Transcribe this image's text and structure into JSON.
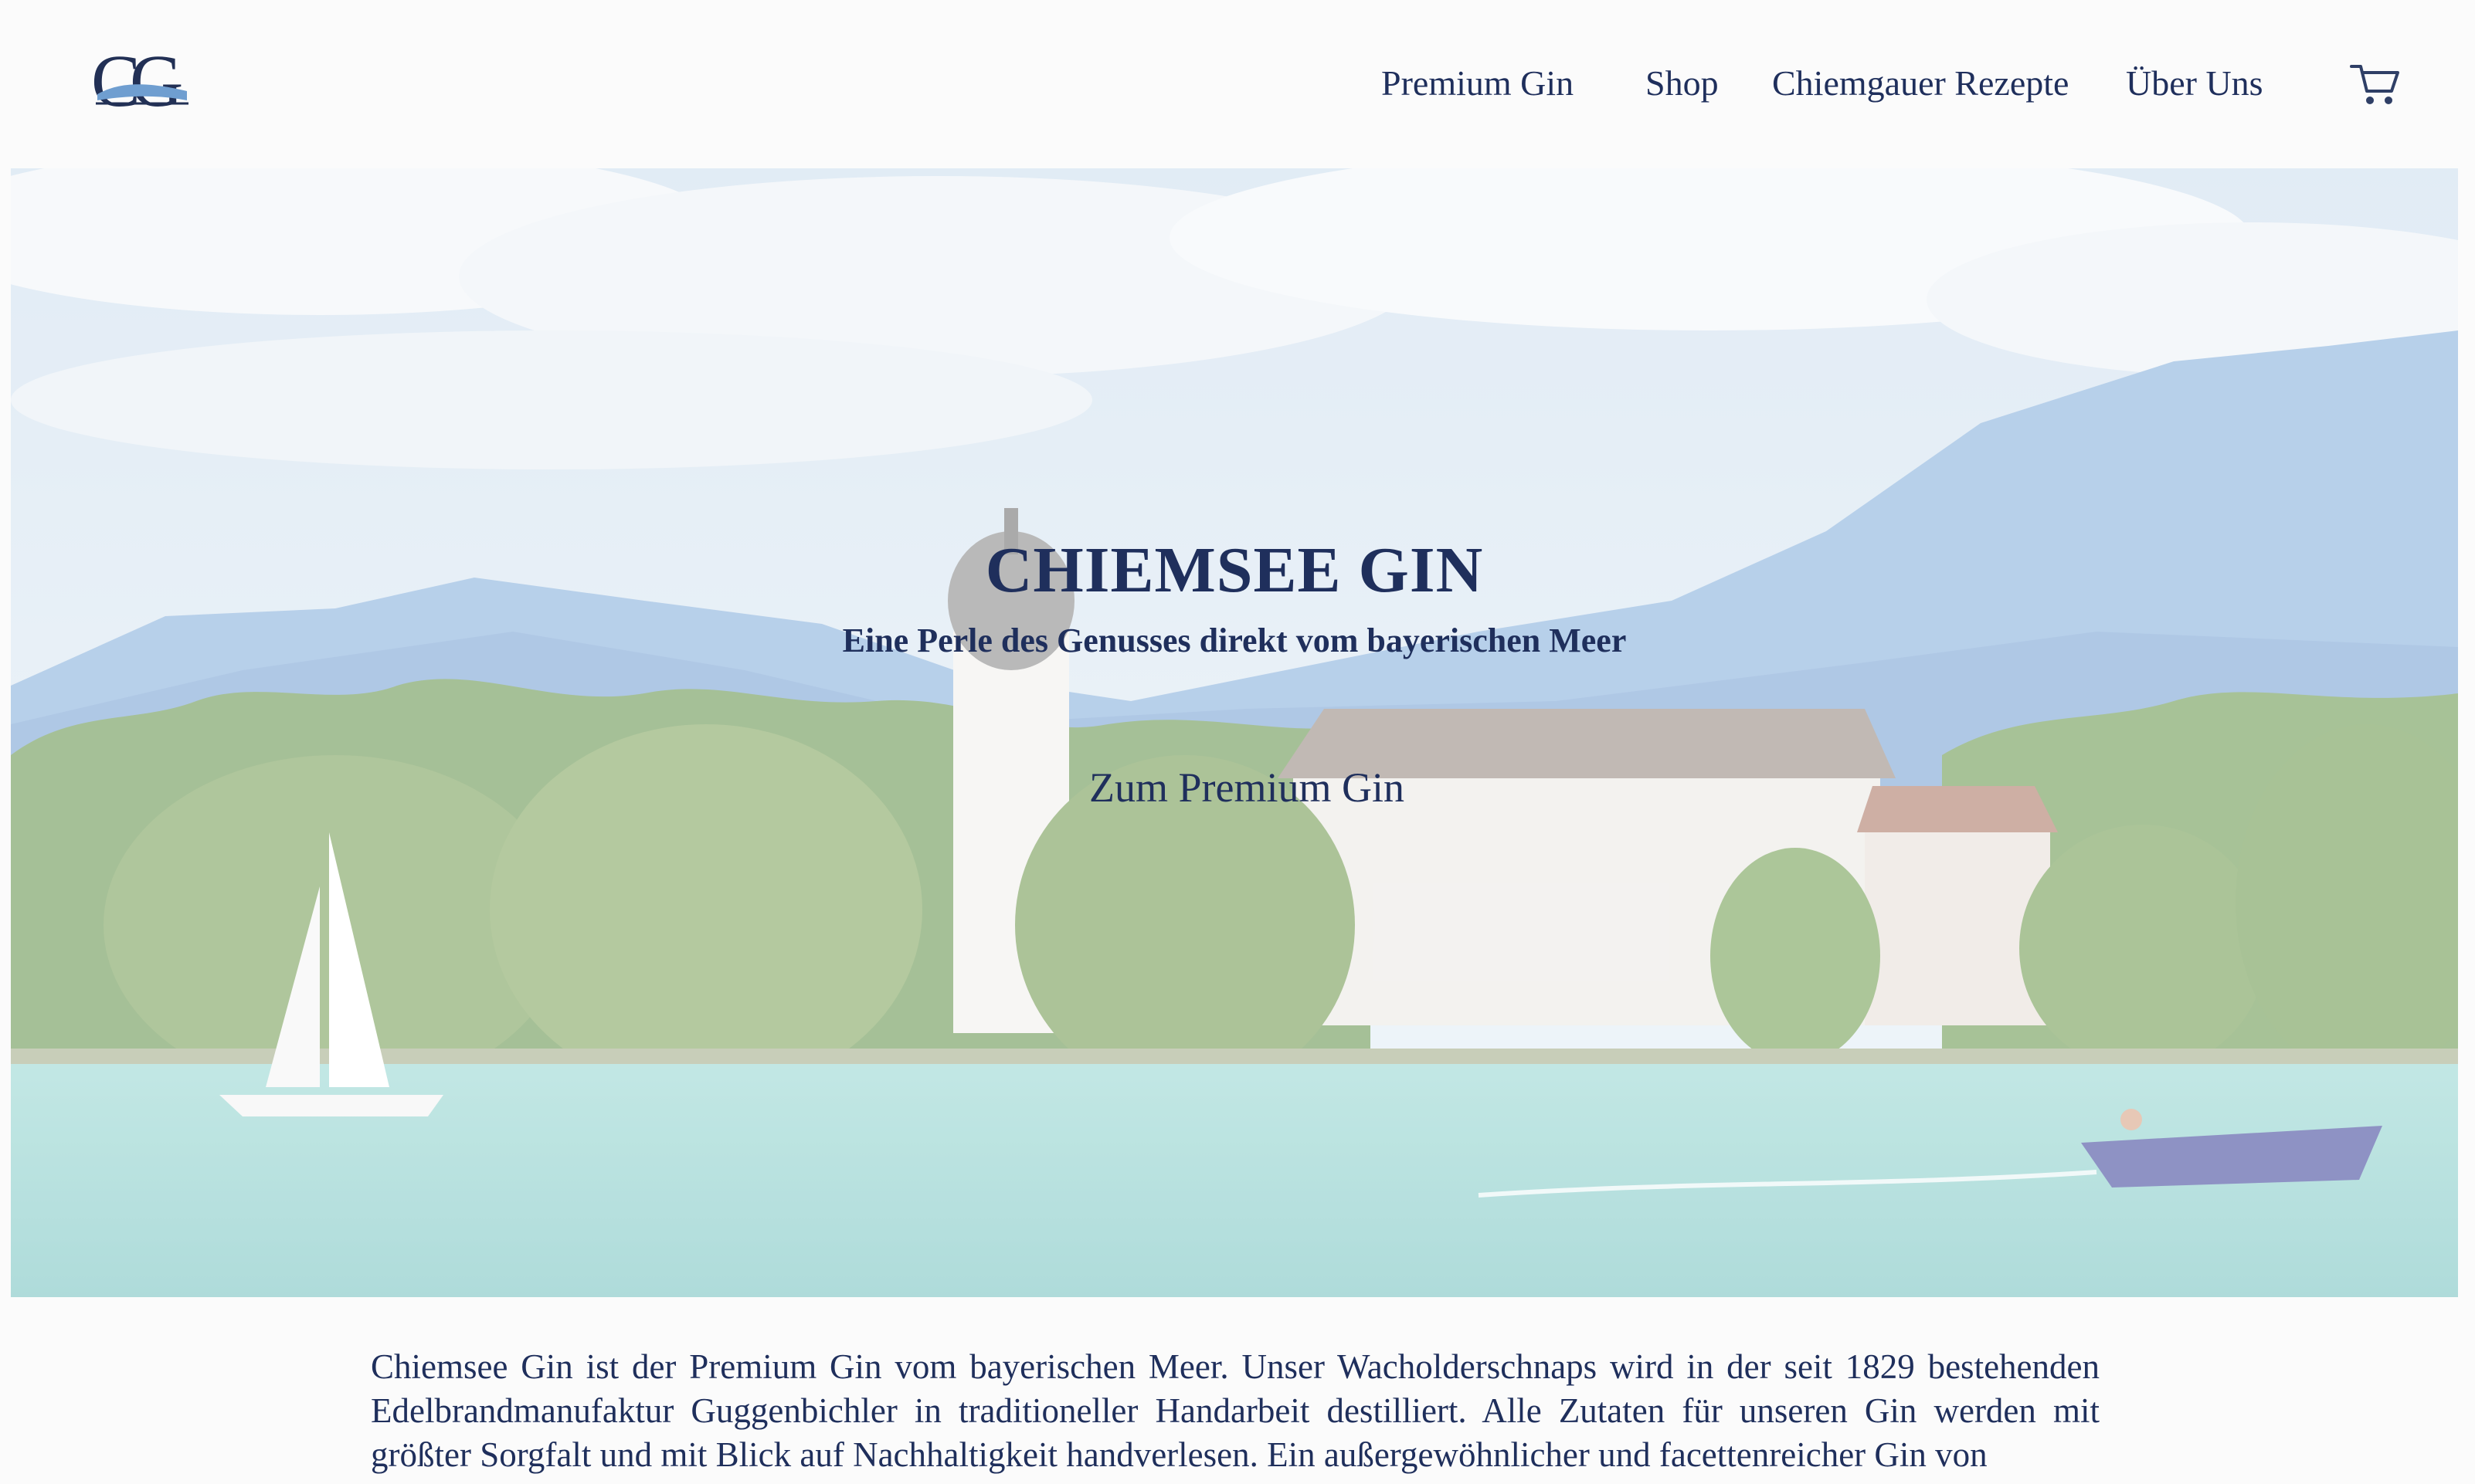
{
  "logo": {
    "text": "CG",
    "icon": "lake-wave-logo"
  },
  "nav": {
    "items": [
      {
        "label": "Premium Gin"
      },
      {
        "label": "Shop"
      },
      {
        "label": "Chiemgauer Rezepte"
      },
      {
        "label": "Über Uns"
      }
    ],
    "cart_icon": "shopping-cart-icon"
  },
  "hero": {
    "title": "CHIEMSEE GIN",
    "subtitle": "Eine Perle des Genusses direkt vom bayerischen Meer",
    "cta": "Zum Premium Gin",
    "image_subject": "lake-island-monastery-scene"
  },
  "intro": {
    "text": "Chiemsee Gin ist der Premium Gin vom bayerischen Meer. Unser Wacholderschnaps wird in der seit 1829 bestehenden Edelbrandmanufaktur Guggenbichler in traditioneller Handarbeit destilliert. Alle Zutaten für unseren Gin werden mit größter Sorgfalt und mit Blick auf Nachhaltigkeit handverlesen. Ein außergewöhnlicher und facettenreicher Gin von"
  },
  "colors": {
    "text": "#1f2f5c",
    "page_bg": "#fbfbfb",
    "lake": "#8fd0cc",
    "mountains": "#7fa9d8"
  }
}
